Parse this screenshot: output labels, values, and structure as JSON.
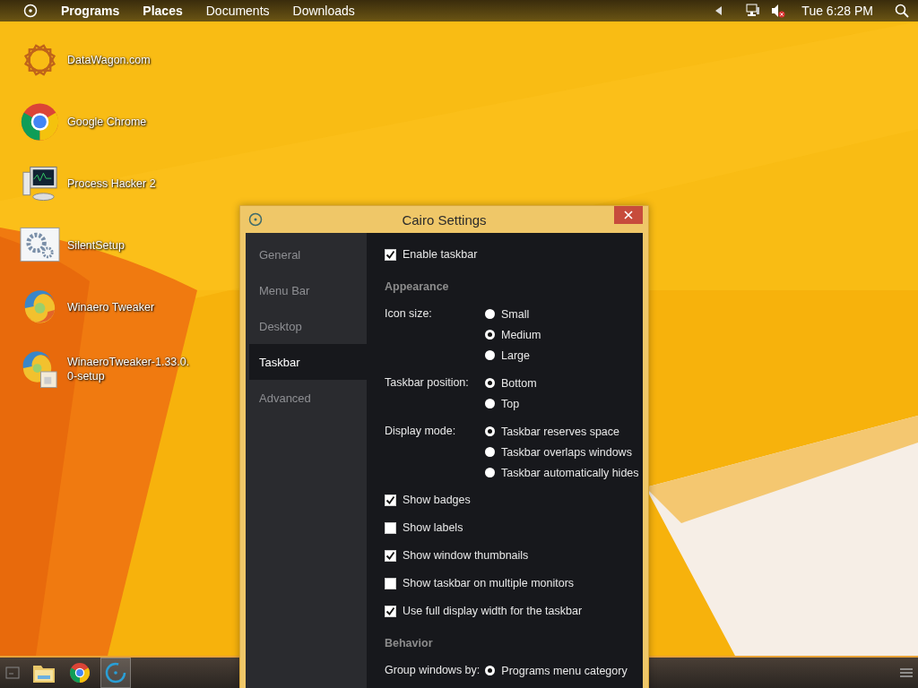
{
  "menu_bar": {
    "items": [
      {
        "label": "Programs",
        "bold": true
      },
      {
        "label": "Places",
        "bold": true
      },
      {
        "label": "Documents",
        "bold": false
      },
      {
        "label": "Downloads",
        "bold": false
      }
    ],
    "clock": "Tue 6:28 PM"
  },
  "desktop_icons": [
    {
      "label": "DataWagon.com",
      "kind": "star"
    },
    {
      "label": "Google Chrome",
      "kind": "chrome"
    },
    {
      "label": "Process Hacker 2",
      "kind": "monitor"
    },
    {
      "label": "SilentSetup",
      "kind": "gears"
    },
    {
      "label": "Winaero Tweaker",
      "kind": "swirl"
    },
    {
      "label": "WinaeroTweaker-1.33.0.0-setup",
      "kind": "installer"
    }
  ],
  "settings_window": {
    "title": "Cairo Settings",
    "sidebar": [
      {
        "label": "General",
        "selected": false
      },
      {
        "label": "Menu Bar",
        "selected": false
      },
      {
        "label": "Desktop",
        "selected": false
      },
      {
        "label": "Taskbar",
        "selected": true
      },
      {
        "label": "Advanced",
        "selected": false
      }
    ],
    "content": [
      {
        "kind": "checkbox",
        "label": "Enable taskbar",
        "checked": true
      },
      {
        "kind": "heading",
        "label": "Appearance"
      },
      {
        "kind": "radio_group",
        "label": "Icon size:",
        "options": [
          {
            "label": "Small",
            "selected": false
          },
          {
            "label": "Medium",
            "selected": true
          },
          {
            "label": "Large",
            "selected": false
          }
        ]
      },
      {
        "kind": "radio_group",
        "label": "Taskbar position:",
        "options": [
          {
            "label": "Bottom",
            "selected": true
          },
          {
            "label": "Top",
            "selected": false
          }
        ]
      },
      {
        "kind": "radio_group",
        "label": "Display mode:",
        "options": [
          {
            "label": "Taskbar reserves space",
            "selected": true
          },
          {
            "label": "Taskbar overlaps windows",
            "selected": false
          },
          {
            "label": "Taskbar automatically hides",
            "selected": false
          }
        ]
      },
      {
        "kind": "checkbox",
        "label": "Show badges",
        "checked": true
      },
      {
        "kind": "checkbox",
        "label": "Show labels",
        "checked": false
      },
      {
        "kind": "checkbox",
        "label": "Show window thumbnails",
        "checked": true
      },
      {
        "kind": "checkbox",
        "label": "Show taskbar on multiple monitors",
        "checked": false
      },
      {
        "kind": "checkbox",
        "label": "Use full display width for the taskbar",
        "checked": true
      },
      {
        "kind": "heading",
        "label": "Behavior"
      },
      {
        "kind": "radio_group",
        "label": "Group windows by:",
        "options": [
          {
            "label": "Programs menu category",
            "selected": true
          }
        ]
      }
    ]
  },
  "taskbar": {
    "items": [
      {
        "kind": "folder",
        "selected": false
      },
      {
        "kind": "chrome",
        "selected": false
      },
      {
        "kind": "cairo",
        "selected": true
      }
    ]
  }
}
